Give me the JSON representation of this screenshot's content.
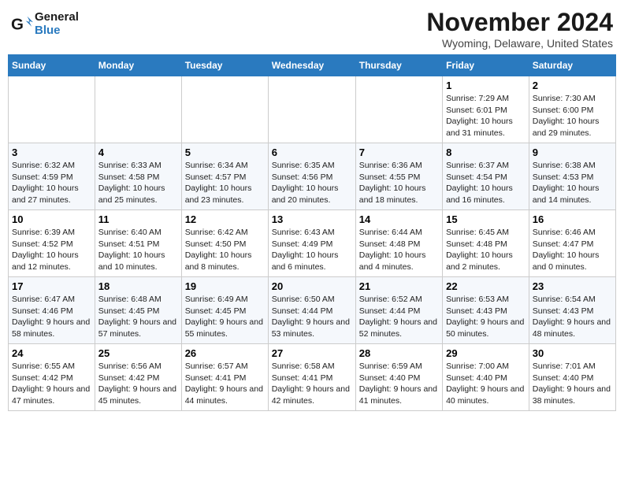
{
  "header": {
    "logo_line1": "General",
    "logo_line2": "Blue",
    "month_title": "November 2024",
    "location": "Wyoming, Delaware, United States"
  },
  "days_of_week": [
    "Sunday",
    "Monday",
    "Tuesday",
    "Wednesday",
    "Thursday",
    "Friday",
    "Saturday"
  ],
  "weeks": [
    [
      {
        "day": "",
        "info": ""
      },
      {
        "day": "",
        "info": ""
      },
      {
        "day": "",
        "info": ""
      },
      {
        "day": "",
        "info": ""
      },
      {
        "day": "",
        "info": ""
      },
      {
        "day": "1",
        "info": "Sunrise: 7:29 AM\nSunset: 6:01 PM\nDaylight: 10 hours and 31 minutes."
      },
      {
        "day": "2",
        "info": "Sunrise: 7:30 AM\nSunset: 6:00 PM\nDaylight: 10 hours and 29 minutes."
      }
    ],
    [
      {
        "day": "3",
        "info": "Sunrise: 6:32 AM\nSunset: 4:59 PM\nDaylight: 10 hours and 27 minutes."
      },
      {
        "day": "4",
        "info": "Sunrise: 6:33 AM\nSunset: 4:58 PM\nDaylight: 10 hours and 25 minutes."
      },
      {
        "day": "5",
        "info": "Sunrise: 6:34 AM\nSunset: 4:57 PM\nDaylight: 10 hours and 23 minutes."
      },
      {
        "day": "6",
        "info": "Sunrise: 6:35 AM\nSunset: 4:56 PM\nDaylight: 10 hours and 20 minutes."
      },
      {
        "day": "7",
        "info": "Sunrise: 6:36 AM\nSunset: 4:55 PM\nDaylight: 10 hours and 18 minutes."
      },
      {
        "day": "8",
        "info": "Sunrise: 6:37 AM\nSunset: 4:54 PM\nDaylight: 10 hours and 16 minutes."
      },
      {
        "day": "9",
        "info": "Sunrise: 6:38 AM\nSunset: 4:53 PM\nDaylight: 10 hours and 14 minutes."
      }
    ],
    [
      {
        "day": "10",
        "info": "Sunrise: 6:39 AM\nSunset: 4:52 PM\nDaylight: 10 hours and 12 minutes."
      },
      {
        "day": "11",
        "info": "Sunrise: 6:40 AM\nSunset: 4:51 PM\nDaylight: 10 hours and 10 minutes."
      },
      {
        "day": "12",
        "info": "Sunrise: 6:42 AM\nSunset: 4:50 PM\nDaylight: 10 hours and 8 minutes."
      },
      {
        "day": "13",
        "info": "Sunrise: 6:43 AM\nSunset: 4:49 PM\nDaylight: 10 hours and 6 minutes."
      },
      {
        "day": "14",
        "info": "Sunrise: 6:44 AM\nSunset: 4:48 PM\nDaylight: 10 hours and 4 minutes."
      },
      {
        "day": "15",
        "info": "Sunrise: 6:45 AM\nSunset: 4:48 PM\nDaylight: 10 hours and 2 minutes."
      },
      {
        "day": "16",
        "info": "Sunrise: 6:46 AM\nSunset: 4:47 PM\nDaylight: 10 hours and 0 minutes."
      }
    ],
    [
      {
        "day": "17",
        "info": "Sunrise: 6:47 AM\nSunset: 4:46 PM\nDaylight: 9 hours and 58 minutes."
      },
      {
        "day": "18",
        "info": "Sunrise: 6:48 AM\nSunset: 4:45 PM\nDaylight: 9 hours and 57 minutes."
      },
      {
        "day": "19",
        "info": "Sunrise: 6:49 AM\nSunset: 4:45 PM\nDaylight: 9 hours and 55 minutes."
      },
      {
        "day": "20",
        "info": "Sunrise: 6:50 AM\nSunset: 4:44 PM\nDaylight: 9 hours and 53 minutes."
      },
      {
        "day": "21",
        "info": "Sunrise: 6:52 AM\nSunset: 4:44 PM\nDaylight: 9 hours and 52 minutes."
      },
      {
        "day": "22",
        "info": "Sunrise: 6:53 AM\nSunset: 4:43 PM\nDaylight: 9 hours and 50 minutes."
      },
      {
        "day": "23",
        "info": "Sunrise: 6:54 AM\nSunset: 4:43 PM\nDaylight: 9 hours and 48 minutes."
      }
    ],
    [
      {
        "day": "24",
        "info": "Sunrise: 6:55 AM\nSunset: 4:42 PM\nDaylight: 9 hours and 47 minutes."
      },
      {
        "day": "25",
        "info": "Sunrise: 6:56 AM\nSunset: 4:42 PM\nDaylight: 9 hours and 45 minutes."
      },
      {
        "day": "26",
        "info": "Sunrise: 6:57 AM\nSunset: 4:41 PM\nDaylight: 9 hours and 44 minutes."
      },
      {
        "day": "27",
        "info": "Sunrise: 6:58 AM\nSunset: 4:41 PM\nDaylight: 9 hours and 42 minutes."
      },
      {
        "day": "28",
        "info": "Sunrise: 6:59 AM\nSunset: 4:40 PM\nDaylight: 9 hours and 41 minutes."
      },
      {
        "day": "29",
        "info": "Sunrise: 7:00 AM\nSunset: 4:40 PM\nDaylight: 9 hours and 40 minutes."
      },
      {
        "day": "30",
        "info": "Sunrise: 7:01 AM\nSunset: 4:40 PM\nDaylight: 9 hours and 38 minutes."
      }
    ]
  ]
}
